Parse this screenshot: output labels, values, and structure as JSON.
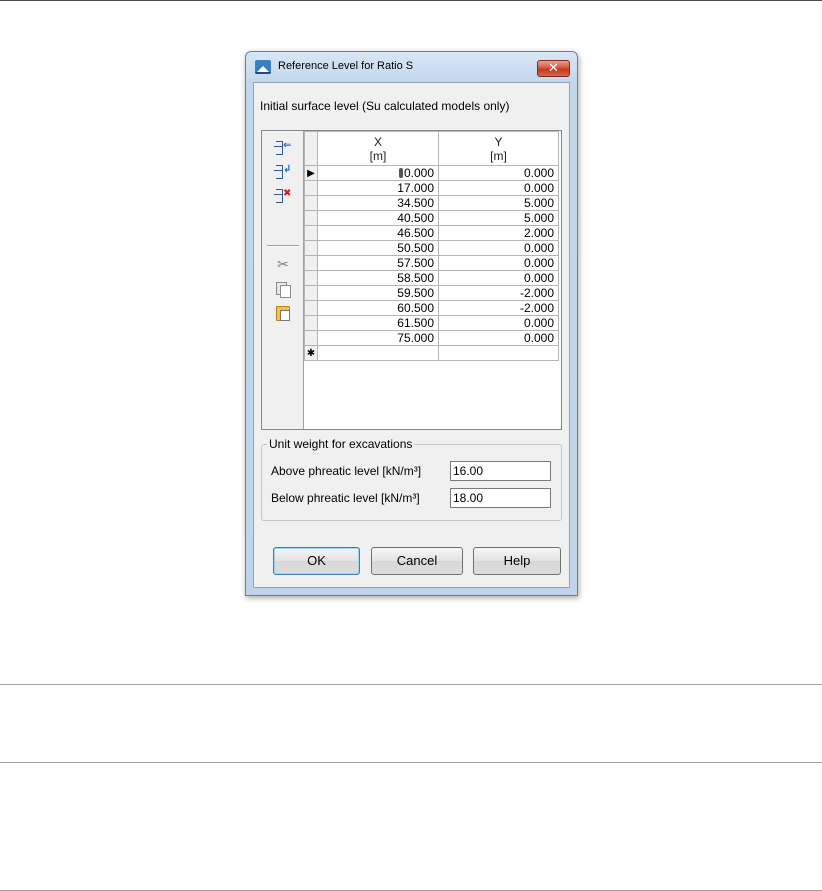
{
  "dialog": {
    "title": "Reference Level for Ratio S",
    "close_label": "✕",
    "heading": "Initial surface level (Su calculated models only)"
  },
  "toolbar": {
    "icons": [
      "add-row-icon",
      "insert-row-icon",
      "delete-row-icon",
      "cut-icon",
      "copy-icon",
      "paste-icon"
    ]
  },
  "grid": {
    "columns": [
      {
        "name": "X",
        "unit": "[m]"
      },
      {
        "name": "Y",
        "unit": "[m]"
      }
    ],
    "rows": [
      {
        "x": "0.000",
        "y": "0.000"
      },
      {
        "x": "17.000",
        "y": "0.000"
      },
      {
        "x": "34.500",
        "y": "5.000"
      },
      {
        "x": "40.500",
        "y": "5.000"
      },
      {
        "x": "46.500",
        "y": "2.000"
      },
      {
        "x": "50.500",
        "y": "0.000"
      },
      {
        "x": "57.500",
        "y": "0.000"
      },
      {
        "x": "58.500",
        "y": "0.000"
      },
      {
        "x": "59.500",
        "y": "-2.000"
      },
      {
        "x": "60.500",
        "y": "-2.000"
      },
      {
        "x": "61.500",
        "y": "0.000"
      },
      {
        "x": "75.000",
        "y": "0.000"
      }
    ],
    "current_row_marker": "▶",
    "new_row_marker": "✱"
  },
  "unit_weight": {
    "legend": "Unit weight for excavations",
    "above_label": "Above phreatic level [kN/m³]",
    "above_value": "16.00",
    "below_label": "Below phreatic level [kN/m³]",
    "below_value": "18.00"
  },
  "buttons": {
    "ok": "OK",
    "cancel": "Cancel",
    "help": "Help"
  }
}
